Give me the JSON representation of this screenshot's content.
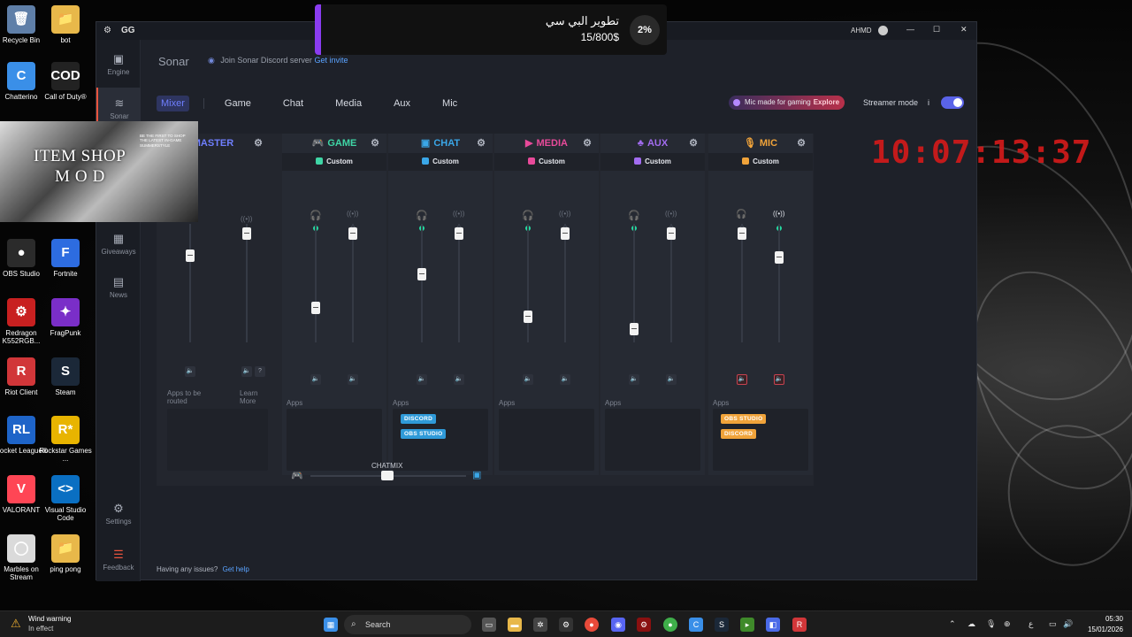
{
  "desktop": {
    "icons": [
      {
        "label": "Recycle Bin",
        "glyph": "🗑",
        "color": "#5f7fa8"
      },
      {
        "label": "bot",
        "glyph": "📁",
        "color": "#e8b84a"
      },
      {
        "label": "Chatterino",
        "glyph": "C",
        "color": "#3a8fe8"
      },
      {
        "label": "Call of Duty®",
        "glyph": "COD",
        "color": "#222"
      },
      {
        "label": "OBS Studio",
        "glyph": "●",
        "color": "#2b2b2b"
      },
      {
        "label": "Fortnite",
        "glyph": "F",
        "color": "#2d6ce0"
      },
      {
        "label": "Redragon K552RGB...",
        "glyph": "⚙",
        "color": "#c82020"
      },
      {
        "label": "FragPunk",
        "glyph": "✦",
        "color": "#7a2ec8"
      },
      {
        "label": "Riot Client",
        "glyph": "R",
        "color": "#d13639"
      },
      {
        "label": "Steam",
        "glyph": "S",
        "color": "#1b2838"
      },
      {
        "label": "Rocket League®",
        "glyph": "RL",
        "color": "#1e64c8"
      },
      {
        "label": "Rockstar Games ...",
        "glyph": "R*",
        "color": "#e8b400"
      },
      {
        "label": "VALORANT",
        "glyph": "V",
        "color": "#ff4655"
      },
      {
        "label": "Visual Studio Code",
        "glyph": "<>",
        "color": "#0a6fc2"
      },
      {
        "label": "Marbles on Stream",
        "glyph": "◯",
        "color": "#dadada"
      },
      {
        "label": "ping pong",
        "glyph": "📁",
        "color": "#e8b84a"
      }
    ]
  },
  "notification": {
    "title": "تطوير البي سي",
    "amount": "15/800$",
    "percent": "2%",
    "accent": "#8a3cf0"
  },
  "window": {
    "logo": "GG",
    "user": "AHMD",
    "controls": {
      "minimize": "—",
      "maximize": "☐",
      "close": "✕"
    }
  },
  "sidebar": {
    "items": [
      {
        "label": "Engine",
        "icon": "chip-icon"
      },
      {
        "label": "Sonar",
        "icon": "sonar-icon"
      },
      {
        "label": "Giveaways",
        "icon": "gift-icon"
      },
      {
        "label": "News",
        "icon": "news-icon"
      },
      {
        "label": "Settings",
        "icon": "gear-icon"
      },
      {
        "label": "Feedback",
        "icon": "feedback-icon"
      }
    ]
  },
  "header": {
    "title": "Sonar",
    "discord_text": "Join Sonar Discord server",
    "discord_link": "Get invite"
  },
  "tabs": [
    "Mixer",
    "Game",
    "Chat",
    "Media",
    "Aux",
    "Mic"
  ],
  "promo": {
    "text": "Mic made for gaming",
    "cta": "Explore"
  },
  "streamer_mode": {
    "label": "Streamer mode",
    "info": "i",
    "enabled": true
  },
  "channels": [
    {
      "name": "MASTER",
      "preset": "",
      "color": "#6f7fff",
      "monitor_level": 0.76,
      "stream_level": 0.97,
      "apps_label": "Apps to be routed",
      "extra_label": "Learn More",
      "apps": []
    },
    {
      "name": "GAME",
      "preset": "Custom",
      "color": "#3fd6a6",
      "monitor_level": 0.27,
      "stream_level": 0.97,
      "apps_label": "Apps",
      "apps": []
    },
    {
      "name": "CHAT",
      "preset": "Custom",
      "color": "#3aa7e8",
      "monitor_level": 0.58,
      "stream_level": 0.97,
      "apps_label": "Apps",
      "apps": [
        "DISCORD",
        "OBS STUDIO"
      ]
    },
    {
      "name": "MEDIA",
      "preset": "Custom",
      "color": "#e84a9a",
      "monitor_level": 0.18,
      "stream_level": 0.97,
      "apps_label": "Apps",
      "apps": []
    },
    {
      "name": "AUX",
      "preset": "Custom",
      "color": "#a26cf0",
      "monitor_level": 0.07,
      "stream_level": 0.97,
      "apps_label": "Apps",
      "apps": []
    },
    {
      "name": "MIC",
      "preset": "Custom",
      "color": "#f0a33a",
      "monitor_level": 0.97,
      "stream_level": 0.74,
      "apps_label": "Apps",
      "apps": [
        "OBS STUDIO",
        "DISCORD"
      ]
    }
  ],
  "chatmix": {
    "label": "CHATMIX",
    "value": 0.5
  },
  "footer": {
    "text": "Having any issues?",
    "link": "Get help"
  },
  "overlays": {
    "item_shop_line1": "ITEM SHOP",
    "item_shop_line2": "MOD",
    "item_shop_fine": "BE THE FIRST TO SHOP THE LATEST IN-GAME SUMMERSTYLE",
    "clock": "10:07:13:37"
  },
  "taskbar": {
    "weather_title": "Wind warning",
    "weather_sub": "In effect",
    "search_placeholder": "Search",
    "time": "05:30",
    "date": "15/01/2026",
    "lang": "ع"
  }
}
